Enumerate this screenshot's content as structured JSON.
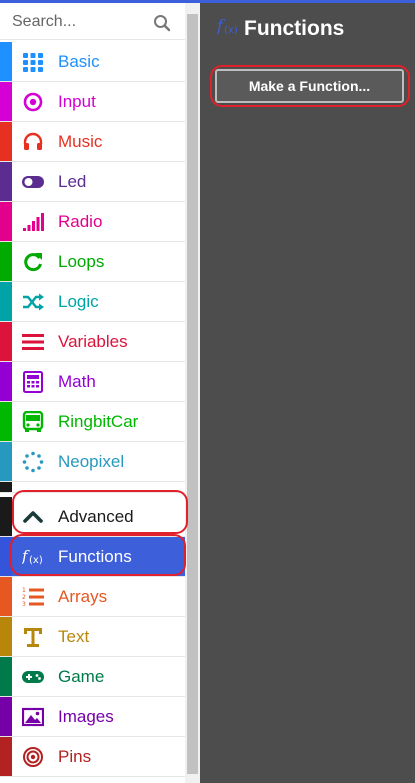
{
  "search": {
    "placeholder": "Search..."
  },
  "categories": [
    {
      "label": "Basic",
      "color": "#1e90ff",
      "icon": "grid-icon"
    },
    {
      "label": "Input",
      "color": "#d400d4",
      "icon": "target-icon"
    },
    {
      "label": "Music",
      "color": "#e63022",
      "icon": "headphones-icon"
    },
    {
      "label": "Led",
      "color": "#5c2d91",
      "icon": "toggle-icon"
    },
    {
      "label": "Radio",
      "color": "#e3008c",
      "icon": "signal-bars-icon"
    },
    {
      "label": "Loops",
      "color": "#00aa00",
      "icon": "refresh-icon"
    },
    {
      "label": "Logic",
      "color": "#00a4a6",
      "icon": "shuffle-icon"
    },
    {
      "label": "Variables",
      "color": "#dc143c",
      "icon": "list-lines-icon"
    },
    {
      "label": "Math",
      "color": "#9400d3",
      "icon": "calculator-icon"
    },
    {
      "label": "RingbitCar",
      "color": "#00b800",
      "icon": "bus-icon"
    },
    {
      "label": "Neopixel",
      "color": "#2699bf",
      "icon": "dotted-circle-icon"
    }
  ],
  "advanced": [
    {
      "label": "Advanced",
      "color": "#1a1a1a",
      "text_color": "#1a1a1a",
      "icon": "chevron-up-icon"
    },
    {
      "label": "Functions",
      "color": "#3455db",
      "text_color": "#ffffff",
      "icon": "function-icon",
      "selected": true
    },
    {
      "label": "Arrays",
      "color": "#e65722",
      "text_color": "#e65722",
      "icon": "numbered-list-icon"
    },
    {
      "label": "Text",
      "color": "#b8860b",
      "text_color": "#b8860b",
      "icon": "text-t-icon"
    },
    {
      "label": "Game",
      "color": "#007a4b",
      "text_color": "#007a4b",
      "icon": "gamepad-icon"
    },
    {
      "label": "Images",
      "color": "#7600a8",
      "text_color": "#7600a8",
      "icon": "image-icon"
    },
    {
      "label": "Pins",
      "color": "#b22222",
      "text_color": "#b22222",
      "icon": "pin-target-icon"
    }
  ],
  "flyout": {
    "title": "Functions",
    "make_function_label": "Make a Function...",
    "background": "#4d4d4d"
  },
  "highlight_color": "#e0202a"
}
